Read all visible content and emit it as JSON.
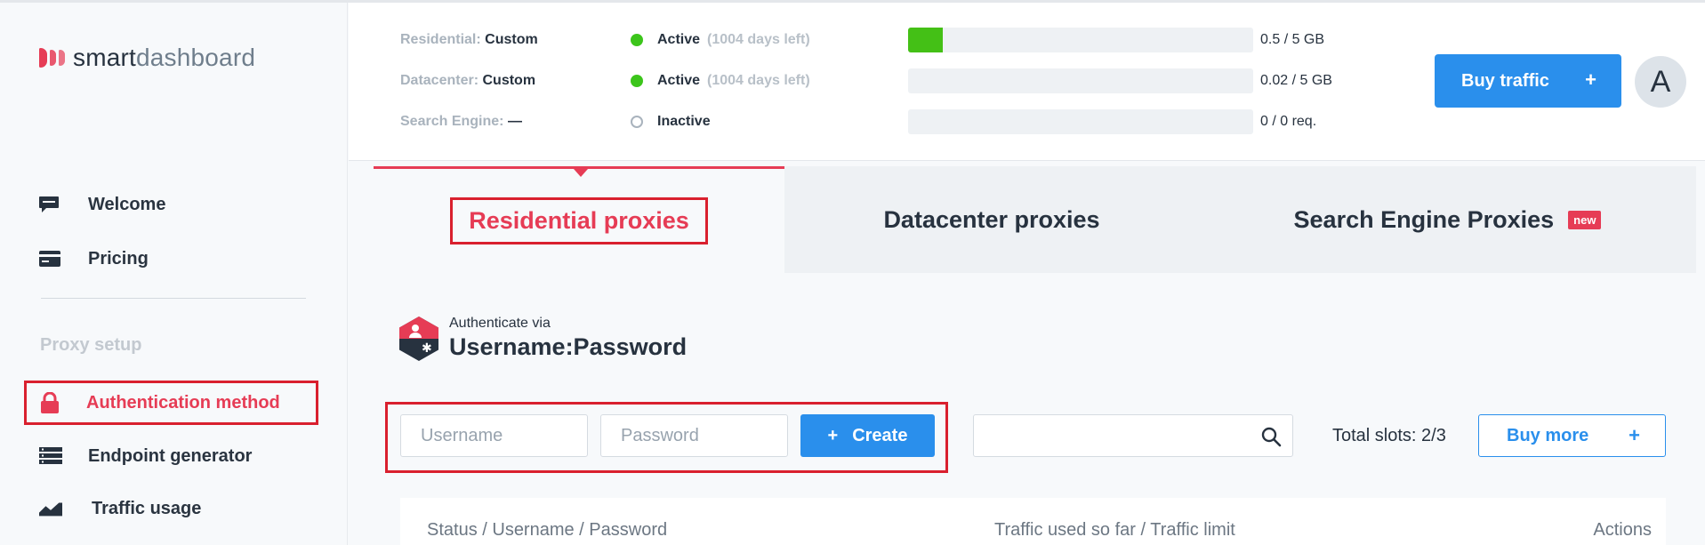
{
  "logo": {
    "part1": "smart",
    "part2": "dashboard"
  },
  "sidebar": {
    "items": [
      {
        "label": "Welcome",
        "icon": "chat-icon"
      },
      {
        "label": "Pricing",
        "icon": "card-icon"
      }
    ],
    "section_title": "Proxy setup",
    "setup_items": [
      {
        "label": "Authentication method",
        "icon": "lock-icon",
        "active": true
      },
      {
        "label": "Endpoint generator",
        "icon": "server-icon"
      },
      {
        "label": "Traffic usage",
        "icon": "chart-icon"
      }
    ]
  },
  "header": {
    "stats": [
      {
        "name": "Residential:",
        "plan": "Custom",
        "status": "Active",
        "days": "(1004 days left)",
        "usage": "0.5 / 5 GB",
        "fraction": 0.1
      },
      {
        "name": "Datacenter:",
        "plan": "Custom",
        "status": "Active",
        "days": "(1004 days left)",
        "usage": "0.02 / 5 GB",
        "fraction": 0.004
      },
      {
        "name": "Search Engine:",
        "plan": "—",
        "status": "Inactive",
        "days": "",
        "usage": "0 / 0 req.",
        "fraction": 0
      }
    ],
    "buy_traffic_label": "Buy traffic",
    "buy_traffic_plus": "+",
    "avatar_letter": "A"
  },
  "tabs": [
    {
      "label": "Residential proxies",
      "active": true
    },
    {
      "label": "Datacenter proxies",
      "active": false
    },
    {
      "label": "Search Engine Proxies",
      "active": false,
      "badge": "new"
    }
  ],
  "auth": {
    "small": "Authenticate via",
    "big": "Username:Password"
  },
  "form": {
    "username_placeholder": "Username",
    "password_placeholder": "Password",
    "create_plus": "+",
    "create_label": "Create",
    "search_placeholder": "",
    "slots": "Total slots: 2/3",
    "buy_more_label": "Buy more",
    "buy_more_plus": "+"
  },
  "table": {
    "columns": [
      "Status / Username / Password",
      "Traffic used so far / Traffic limit",
      "Actions"
    ]
  },
  "colors": {
    "accent": "#e63c55",
    "primary": "#2a8fec",
    "active_green": "#3cc51b",
    "highlight_red": "#d9202e"
  }
}
